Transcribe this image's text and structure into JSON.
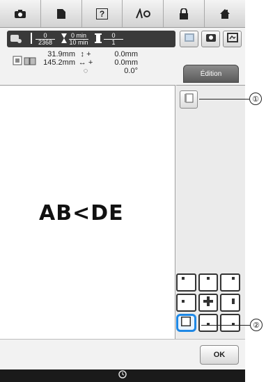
{
  "toolbar": {
    "items": [
      {
        "name": "camera-icon"
      },
      {
        "name": "document-icon"
      },
      {
        "name": "help-icon",
        "label": "?"
      },
      {
        "name": "thread-trim-icon"
      },
      {
        "name": "lock-icon"
      },
      {
        "name": "home-icon"
      }
    ]
  },
  "status": {
    "color_count": {
      "numerator": "0",
      "denominator": "2368"
    },
    "time": {
      "numerator": "0 min",
      "denominator": "10 min"
    },
    "thread": {
      "numerator": "0",
      "denominator": "1"
    }
  },
  "dimensions": {
    "height_value": "31.9mm",
    "width_value": "145.2mm",
    "vertical_offset": "0.0mm",
    "horizontal_offset": "0.0mm",
    "rotation": "0.0°",
    "plus_sign": "+"
  },
  "edit_tab": {
    "label": "Édition"
  },
  "canvas": {
    "pattern_text": "AB<DE"
  },
  "ok_button": {
    "label": "OK"
  },
  "callouts": {
    "one": "①",
    "two": "②"
  },
  "colors": {
    "selected": "#1e88e5",
    "statusbar": "#3a3a3a"
  }
}
